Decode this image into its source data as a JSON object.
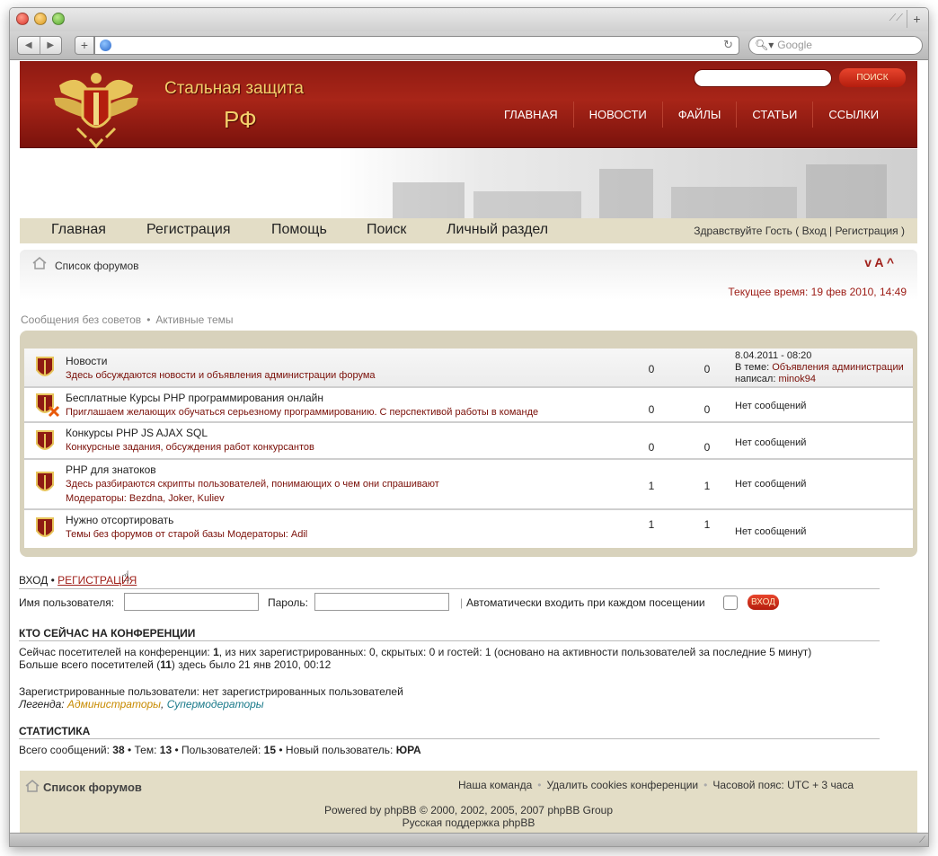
{
  "browser": {
    "address": "",
    "search_placeholder": "Google"
  },
  "site": {
    "title": "Стальная защита",
    "subtitle": "РФ",
    "search_button": "ПОИСК",
    "top_nav": [
      "ГЛАВНАЯ",
      "НОВОСТИ",
      "ФАЙЛЫ",
      "СТАТЬИ",
      "ССЫЛКИ"
    ]
  },
  "nav2": {
    "items": [
      "Главная",
      "Регистрация",
      "Помощь",
      "Поиск",
      "Личный раздел"
    ],
    "greeting": "Здравствуйте Гость ( Вход | Регистрация )"
  },
  "crumbs": {
    "forum_list": "Список форумов",
    "font_size": "v A ^",
    "current_time": "Текущее время: 19 фев 2010, 14:49",
    "sub_links": [
      "Сообщения без советов",
      "Активные темы"
    ]
  },
  "forums": [
    {
      "title": "Новости",
      "desc": "Здесь обсуждаются новости и объявления администрации форума",
      "mods": "",
      "topics": "0",
      "posts": "0",
      "last": [
        "8.04.2011 - 08:20",
        "В теме:",
        "Объявления администрации",
        "написал:",
        "minok94"
      ],
      "locked": false
    },
    {
      "title": "Бесплатные Курсы PHP программирования онлайн",
      "desc": "Приглашаем желающих обучаться серьезному программированию. С перспективой работы в команде",
      "mods": "",
      "topics": "0",
      "posts": "0",
      "last": [
        "Нет сообщений"
      ],
      "locked": true
    },
    {
      "title": "Конкурсы PHP JS AJAX SQL",
      "desc": "Конкурсные задания, обсуждения работ конкурсантов",
      "mods": "",
      "topics": "0",
      "posts": "0",
      "last": [
        "Нет сообщений"
      ],
      "locked": false
    },
    {
      "title": "PHP для знатоков",
      "desc": "Здесь разбираются скрипты пользователей, понимающих о чем они спрашивают",
      "mods": "Модераторы: Bezdna, Joker, Kuliev",
      "topics": "1",
      "posts": "1",
      "last": [
        "Нет сообщений"
      ],
      "locked": false
    },
    {
      "title": "Нужно отсортировать",
      "desc": "Темы без форумов от старой базы Модераторы: Adil",
      "mods": "",
      "topics": "1",
      "posts": "1",
      "last": [
        "Нет сообщений"
      ],
      "locked": false
    }
  ],
  "login": {
    "title": "ВХОД",
    "register": "РЕГИСТРАЦИЯ",
    "username_label": "Имя пользователя:",
    "password_label": "Пароль:",
    "auto_label": "Автоматически входить при каждом посещении",
    "button": "ВХОД"
  },
  "online": {
    "title": "КТО СЕЙЧАС НА КОНФЕРЕНЦИИ",
    "line1_pre": "Сейчас посетителей на конференции: ",
    "line1_bold": "1",
    "line1_post": ", из них зарегистрированных: 0, скрытых: 0 и гостей: 1 (основано на активности пользователей за последние 5 минут)",
    "line2_pre": "Больше всего посетителей (",
    "line2_bold": "11",
    "line2_post": ") здесь было 21 янв 2010, 00:12",
    "registered": "Зарегистрированные пользователи: нет зарегистрированных пользователей",
    "legend": "Легенда:",
    "admins": "Администраторы",
    "smods": "Супермодераторы"
  },
  "stats": {
    "title": "СТАТИСТИКА",
    "pre1": "Всего сообщений: ",
    "v1": "38",
    "pre2": " • Тем: ",
    "v2": "13",
    "pre3": " • Пользователей: ",
    "v3": "15",
    "pre4": " • Новый пользователь: ",
    "v4": "ЮРА"
  },
  "footer": {
    "forums": "Список форумов",
    "team": "Наша команда",
    "cookies": "Удалить cookies конференции",
    "tz": "Часовой пояс: UTC + 3 часа",
    "powered": "Powered by phpBB © 2000, 2002, 2005, 2007 phpBB Group",
    "support": "Русская поддержка phpBB"
  },
  "colors": {
    "header_red": "#a82518",
    "beige": "#e3ddc6",
    "link_red": "#7a0f08"
  }
}
